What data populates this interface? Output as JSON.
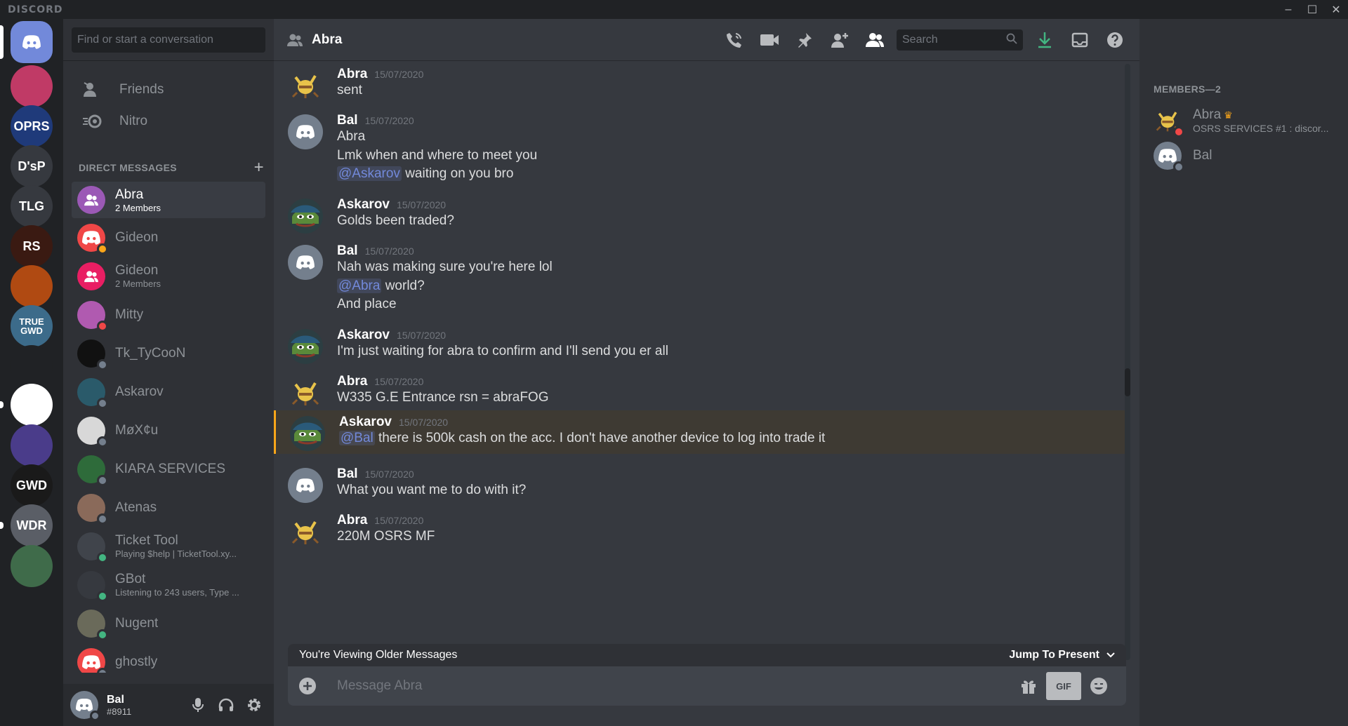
{
  "app": {
    "brand": "DISCORD"
  },
  "window_controls": {
    "minimize": "–",
    "maximize": "☐",
    "close": "✕"
  },
  "servers": [
    {
      "id": "home",
      "label": "",
      "color": "#7289da"
    },
    {
      "id": "s1",
      "label": "",
      "color": "#c03a66"
    },
    {
      "id": "s2",
      "label": "OPRS",
      "color": "#1f3a7a"
    },
    {
      "id": "s3",
      "label": "D'sP",
      "color": "#36393f"
    },
    {
      "id": "s4",
      "label": "TLG",
      "color": "#36393f"
    },
    {
      "id": "s5",
      "label": "RS",
      "color": "#3a1a12"
    },
    {
      "id": "s6",
      "label": "",
      "color": "#b04a12"
    },
    {
      "id": "s7",
      "label": "TRUE GWD",
      "color": "#3c6b8a"
    },
    {
      "id": "s8",
      "label": "",
      "color": "#202225"
    },
    {
      "id": "s9",
      "label": "",
      "color": "#ffffff"
    },
    {
      "id": "s10",
      "label": "",
      "color": "#4a3c8a"
    },
    {
      "id": "s11",
      "label": "GWD",
      "color": "#1a1a1a"
    },
    {
      "id": "s12",
      "label": "WDR",
      "color": "#5a5e66"
    },
    {
      "id": "s13",
      "label": "",
      "color": "#3f6b4a"
    }
  ],
  "dm_sidebar": {
    "search_placeholder": "Find or start a conversation",
    "nav": [
      {
        "label": "Friends",
        "icon": "friends-icon"
      },
      {
        "label": "Nitro",
        "icon": "nitro-icon"
      }
    ],
    "section_title": "DIRECT MESSAGES",
    "add_label": "+",
    "items": [
      {
        "name": "Abra",
        "sub": "2 Members",
        "color": "#9b59b6",
        "status": "",
        "active": true,
        "group": true
      },
      {
        "name": "Gideon",
        "sub": "",
        "color": "#f04747",
        "status": "#faa61a",
        "active": false,
        "group": false
      },
      {
        "name": "Gideon",
        "sub": "2 Members",
        "color": "#e91e63",
        "status": "",
        "active": false,
        "group": true
      },
      {
        "name": "Mitty",
        "sub": "",
        "color": "#b05ab0",
        "status": "#f04747",
        "active": false,
        "group": false
      },
      {
        "name": "Tk_TyCooN",
        "sub": "",
        "color": "#111111",
        "status": "#747f8d",
        "active": false,
        "group": false
      },
      {
        "name": "Askarov",
        "sub": "",
        "color": "#2a5a6a",
        "status": "#747f8d",
        "active": false,
        "group": false
      },
      {
        "name": "MøX¢u",
        "sub": "",
        "color": "#d8d8d8",
        "status": "#747f8d",
        "active": false,
        "group": false
      },
      {
        "name": "KIARA SERVICES",
        "sub": "",
        "color": "#2e6b3a",
        "status": "#747f8d",
        "active": false,
        "group": false
      },
      {
        "name": "Atenas",
        "sub": "",
        "color": "#8a6a5a",
        "status": "#747f8d",
        "active": false,
        "group": false
      },
      {
        "name": "Ticket Tool",
        "sub": "Playing $help | TicketTool.xy...",
        "color": "#40444b",
        "status": "#43b581",
        "active": false,
        "group": false
      },
      {
        "name": "GBot",
        "sub": "Listening to 243 users, Type ...",
        "color": "#36393f",
        "status": "#43b581",
        "active": false,
        "group": false
      },
      {
        "name": "Nugent",
        "sub": "",
        "color": "#6a6a5a",
        "status": "#43b581",
        "active": false,
        "group": false
      },
      {
        "name": "ghostly",
        "sub": "",
        "color": "#f04747",
        "status": "#747f8d",
        "active": false,
        "group": false
      }
    ]
  },
  "user_panel": {
    "name": "Bal",
    "tag": "#8911"
  },
  "chat": {
    "channel_name": "Abra",
    "search_placeholder": "Search",
    "messages": [
      {
        "author": "Abra",
        "time": "15/07/2020",
        "avatar": "abra",
        "lines": [
          [
            {
              "t": "sent"
            }
          ]
        ]
      },
      {
        "author": "Bal",
        "time": "15/07/2020",
        "avatar": "discord",
        "lines": [
          [
            {
              "t": "Abra"
            }
          ],
          [
            {
              "t": "Lmk when and where to meet you"
            }
          ],
          [
            {
              "m": "@Askarov"
            },
            {
              "t": " waiting on you bro"
            }
          ]
        ]
      },
      {
        "author": "Askarov",
        "time": "15/07/2020",
        "avatar": "pepe",
        "lines": [
          [
            {
              "t": "Golds been traded?"
            }
          ]
        ]
      },
      {
        "author": "Bal",
        "time": "15/07/2020",
        "avatar": "discord",
        "lines": [
          [
            {
              "t": "Nah was making sure you're here lol"
            }
          ],
          [
            {
              "m": "@Abra"
            },
            {
              "t": " world?"
            }
          ],
          [
            {
              "t": "And place"
            }
          ]
        ]
      },
      {
        "author": "Askarov",
        "time": "15/07/2020",
        "avatar": "pepe",
        "lines": [
          [
            {
              "t": "I'm just waiting for abra to confirm and I'll send you er all"
            }
          ]
        ]
      },
      {
        "author": "Abra",
        "time": "15/07/2020",
        "avatar": "abra",
        "lines": [
          [
            {
              "t": "W335  G.E Entrance rsn = abraFOG"
            }
          ]
        ]
      },
      {
        "author": "Askarov",
        "time": "15/07/2020",
        "avatar": "pepe",
        "highlight": true,
        "lines": [
          [
            {
              "m": "@Bal"
            },
            {
              "t": " there is 500k cash on the acc. I don't have another device to log into trade it"
            }
          ]
        ]
      },
      {
        "author": "Bal",
        "time": "15/07/2020",
        "avatar": "discord",
        "lines": [
          [
            {
              "t": "What you want me to do with it?"
            }
          ]
        ]
      },
      {
        "author": "Abra",
        "time": "15/07/2020",
        "avatar": "abra",
        "lines": [
          [
            {
              "t": "220M OSRS MF"
            }
          ]
        ]
      }
    ],
    "older_notice": "You're Viewing Older Messages",
    "jump_label": "Jump To Present",
    "composer_placeholder": "Message Abra",
    "gif_label": "GIF"
  },
  "members": {
    "header": "MEMBERS—2",
    "list": [
      {
        "name": "Abra",
        "sub": "OSRS SERVICES #1 : discor...",
        "avatar": "abra",
        "status": "#f04747",
        "owner": true
      },
      {
        "name": "Bal",
        "sub": "",
        "avatar": "discord",
        "status": "#747f8d",
        "owner": false
      }
    ]
  }
}
